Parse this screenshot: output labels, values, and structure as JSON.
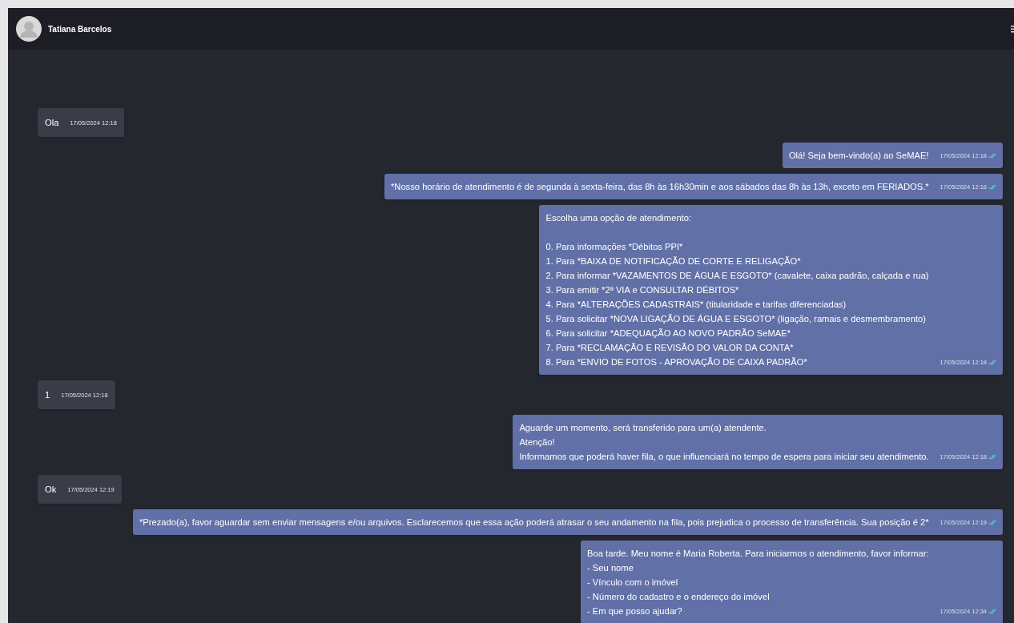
{
  "header": {
    "contact_name": "Tatiana Barcelos"
  },
  "messages": [
    {
      "kind": "incoming",
      "text": "Ola",
      "time": "17/05/2024 12:18"
    },
    {
      "kind": "outgoing",
      "text": "Olá! Seja bem-vindo(a) ao SeMAE!",
      "time": "17/05/2024 12:18",
      "read": true
    },
    {
      "kind": "outgoing",
      "text": "*Nosso horário de atendimento é de segunda à sexta-feira, das 8h às 16h30min e aos sábados das 8h às 13h, exceto em FERIADOS.*",
      "time": "17/05/2024 12:18",
      "read": true
    },
    {
      "kind": "outgoing",
      "text": "Escolha uma opção de atendimento:\n\n0. Para informações *Débitos PPI*\n1. Para *BAIXA DE NOTIFICAÇÃO DE CORTE E RELIGAÇÃO*\n2. Para informar *VAZAMENTOS DE ÁGUA E ESGOTO* (cavalete, caixa padrão, calçada e rua)\n3. Para emitir *2ª VIA e CONSULTAR DÉBITOS*\n4. Para *ALTERAÇÕES CADASTRAIS* (titularidade e tarifas diferenciadas)\n5. Para solicitar *NOVA LIGAÇÃO DE ÁGUA E ESGOTO* (ligação, ramais e desmembramento)\n6. Para solicitar *ADEQUAÇÃO AO NOVO PADRÃO SeMAE*\n7. Para *RECLAMAÇÃO E REVISÃO DO VALOR DA CONTA*\n8. Para *ENVIO DE FOTOS - APROVAÇÃO DE CAIXA PADRÃO*",
      "time": "17/05/2024 12:18",
      "read": true
    },
    {
      "kind": "incoming",
      "text": "1",
      "time": "17/05/2024 12:18"
    },
    {
      "kind": "outgoing",
      "text": "Aguarde um momento, será transferido para um(a) atendente.\nAtenção!\nInformamos que poderá haver fila, o que influenciará no tempo de espera para iniciar seu atendimento.",
      "time": "17/05/2024 12:18",
      "read": true
    },
    {
      "kind": "incoming",
      "text": "Ok",
      "time": "17/05/2024 12:19"
    },
    {
      "kind": "outgoing",
      "text": "*Prezado(a), favor aguardar sem enviar mensagens e/ou arquivos. Esclarecemos que essa ação poderá atrasar o seu andamento na fila, pois prejudica o processo de transferência. Sua posição é 2*",
      "time": "17/05/2024 12:19",
      "read": true
    },
    {
      "kind": "outgoing",
      "text": "Boa tarde. Meu nome é Maria Roberta. Para iniciarmos o atendimento, favor informar:\n- Seu nome\n- Vínculo com o imóvel\n- Número do cadastro e o endereço do imóvel\n- Em que posso ajudar?",
      "time": "17/05/2024 12:34",
      "read": true
    }
  ]
}
